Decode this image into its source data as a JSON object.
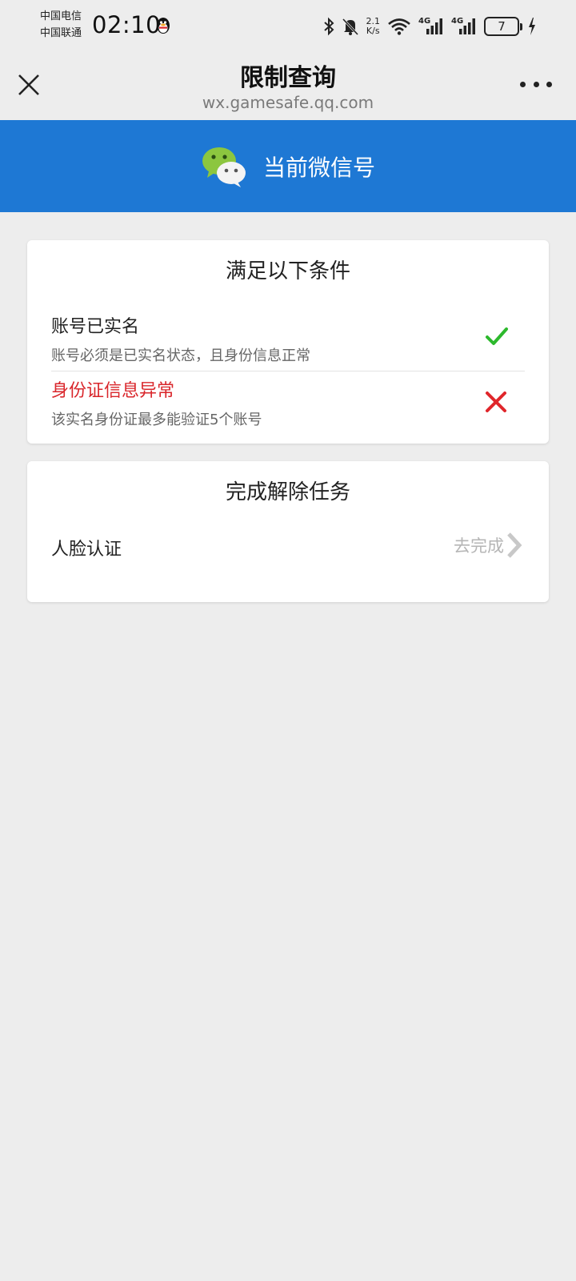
{
  "status_bar": {
    "carrier_1": "中国电信",
    "carrier_2": "中国联通",
    "time": "02:10",
    "net_speed_value": "2.1",
    "net_speed_unit": "K/s",
    "signal_1_label": "4G",
    "signal_2_label": "4G",
    "battery_level": "7"
  },
  "nav": {
    "title": "限制查询",
    "subtitle": "wx.gamesafe.qq.com"
  },
  "banner": {
    "label": "当前微信号"
  },
  "conditions_card": {
    "title": "满足以下条件",
    "items": [
      {
        "title": "账号已实名",
        "description": "账号必须是已实名状态，且身份信息正常",
        "status": "ok"
      },
      {
        "title": "身份证信息异常",
        "description": "该实名身份证最多能验证5个账号",
        "status": "error"
      }
    ]
  },
  "tasks_card": {
    "title": "完成解除任务",
    "items": [
      {
        "label": "人脸认证",
        "action": "去完成"
      }
    ]
  },
  "colors": {
    "banner_bg": "#1e78d4",
    "ok_icon": "#2db92d",
    "error_icon": "#e0262b",
    "error_text": "#d9262b"
  }
}
